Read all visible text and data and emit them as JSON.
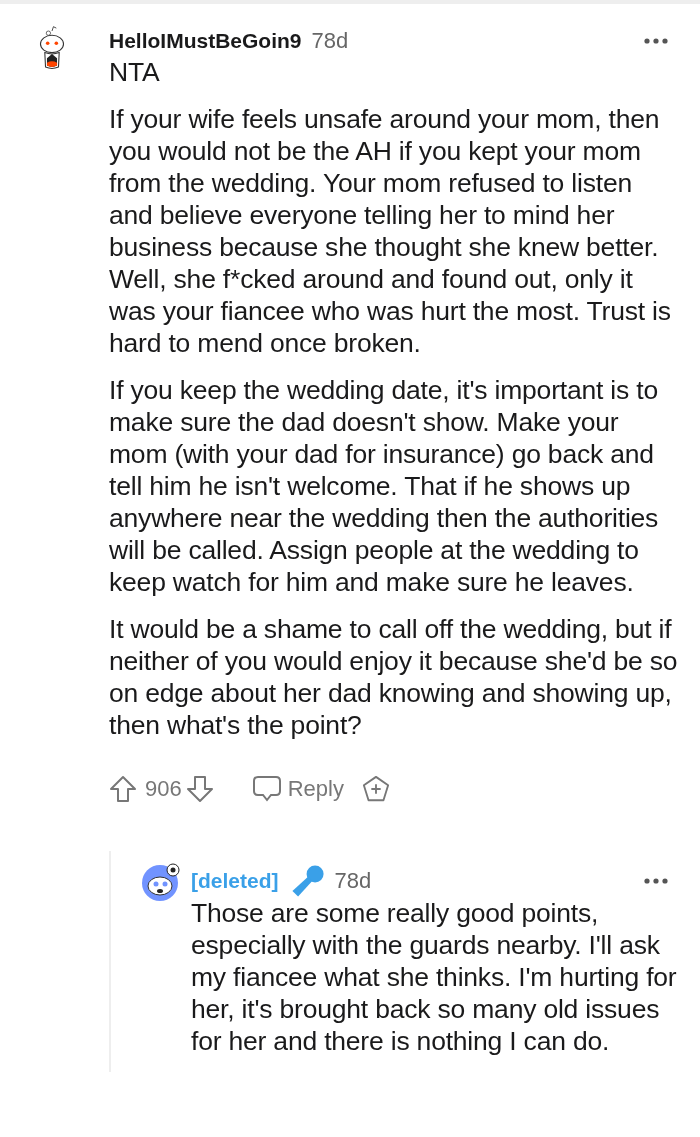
{
  "comments": [
    {
      "kind": "top",
      "author": "HelloIMustBeGoin9",
      "age": "78d",
      "paragraphs": [
        "NTA",
        "If your wife feels unsafe around your mom, then you would not be the AH if you kept your mom from the wedding. Your mom refused to listen and believe everyone telling her to mind her business because she thought she knew better. Well, she f*cked around and found out, only it was your fiancee who was hurt the most. Trust is hard to mend once broken.",
        "If you keep the wedding date, it's important is to make sure the dad doesn't show. Make your mom (with your dad for insurance) go back and tell him he isn't welcome. That if he shows up anywhere near the wedding then the authorities will be called. Assign people at the wedding to keep watch for him and make sure he leaves.",
        "It would be a shame to call off the wedding, but if neither of you would enjoy it because she'd be so on edge about her dad knowing and showing up, then what's the point?"
      ],
      "score": "906",
      "reply_label": "Reply"
    },
    {
      "kind": "reply",
      "author": "[deleted]",
      "age": "78d",
      "paragraphs": [
        "Those are some really good points, especially with the guards nearby. I'll ask my fiancee what she thinks. I'm hurting for her, it's brought back so many old issues for her and there is nothing I can do."
      ]
    }
  ]
}
